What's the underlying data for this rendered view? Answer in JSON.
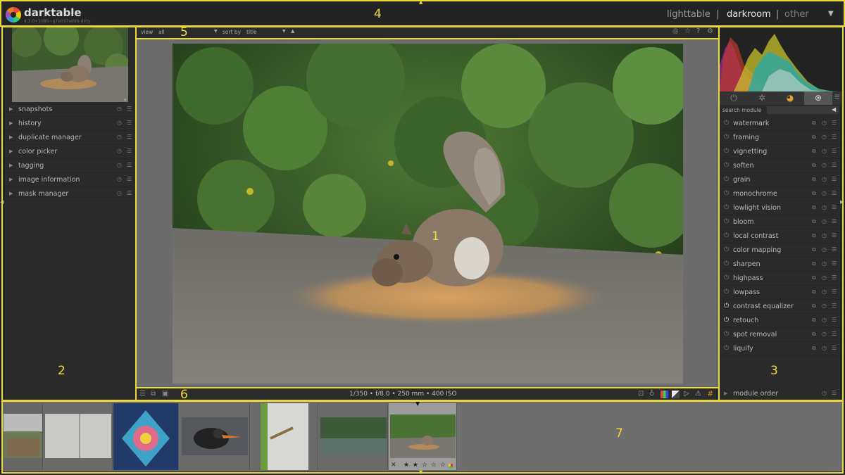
{
  "header": {
    "app_name": "darktable",
    "version": "4.3.0+1085~g7e037ed9b-dirty",
    "views": [
      "lighttable",
      "darkroom",
      "other"
    ],
    "separator": "|",
    "active_view": "darkroom",
    "menu_icon": "chevron-down-icon"
  },
  "top_toolbar": {
    "view_label": "view",
    "view_value": "all",
    "sort_label": "sort by",
    "sort_value": "title",
    "sort_dir_icon": "sort-ascending-icon",
    "icons": [
      "grouping-icon",
      "star-icon",
      "help-icon",
      "preferences-icon"
    ]
  },
  "left_panel": {
    "modules": [
      {
        "label": "snapshots"
      },
      {
        "label": "history"
      },
      {
        "label": "duplicate manager"
      },
      {
        "label": "color picker"
      },
      {
        "label": "tagging"
      },
      {
        "label": "image information"
      },
      {
        "label": "mask manager"
      }
    ]
  },
  "right_panel": {
    "search_label": "search module",
    "modules": [
      {
        "label": "watermark",
        "on": false
      },
      {
        "label": "framing",
        "on": false
      },
      {
        "label": "vignetting",
        "on": false
      },
      {
        "label": "soften",
        "on": false
      },
      {
        "label": "grain",
        "on": false
      },
      {
        "label": "monochrome",
        "on": false
      },
      {
        "label": "lowlight vision",
        "on": false
      },
      {
        "label": "bloom",
        "on": false
      },
      {
        "label": "local contrast",
        "on": false
      },
      {
        "label": "color mapping",
        "on": false
      },
      {
        "label": "sharpen",
        "on": false
      },
      {
        "label": "highpass",
        "on": false
      },
      {
        "label": "lowpass",
        "on": false
      },
      {
        "label": "contrast equalizer",
        "on": true
      },
      {
        "label": "retouch",
        "on": true
      },
      {
        "label": "spot removal",
        "on": false
      },
      {
        "label": "liquify",
        "on": false
      }
    ],
    "module_order_label": "module order",
    "tab_icons": [
      "power-icon",
      "favorite-icon",
      "color-wheel-icon",
      "effects-icon"
    ]
  },
  "bottom_toolbar": {
    "exif": "1/350 • f/8.0 • 250 mm • 400 ISO",
    "left_icons": [
      "presets-icon",
      "styles-icon",
      "second-window-icon"
    ],
    "right_icons": [
      "focus-peaking-icon",
      "color-assessment-icon",
      "raw-overexposed-icon",
      "clipping-icon",
      "softproof-icon",
      "gamut-check-icon",
      "guides-icon"
    ]
  },
  "filmstrip": {
    "selected_rating": "★ ★ ☆ ☆ ☆",
    "reject_icon": "✕"
  },
  "annotations": [
    "1",
    "2",
    "3",
    "4",
    "5",
    "6",
    "7"
  ],
  "colors": {
    "annotation": "#e9d83a",
    "panel_bg": "#2a2a2a",
    "center_bg": "#6b6b6b"
  }
}
